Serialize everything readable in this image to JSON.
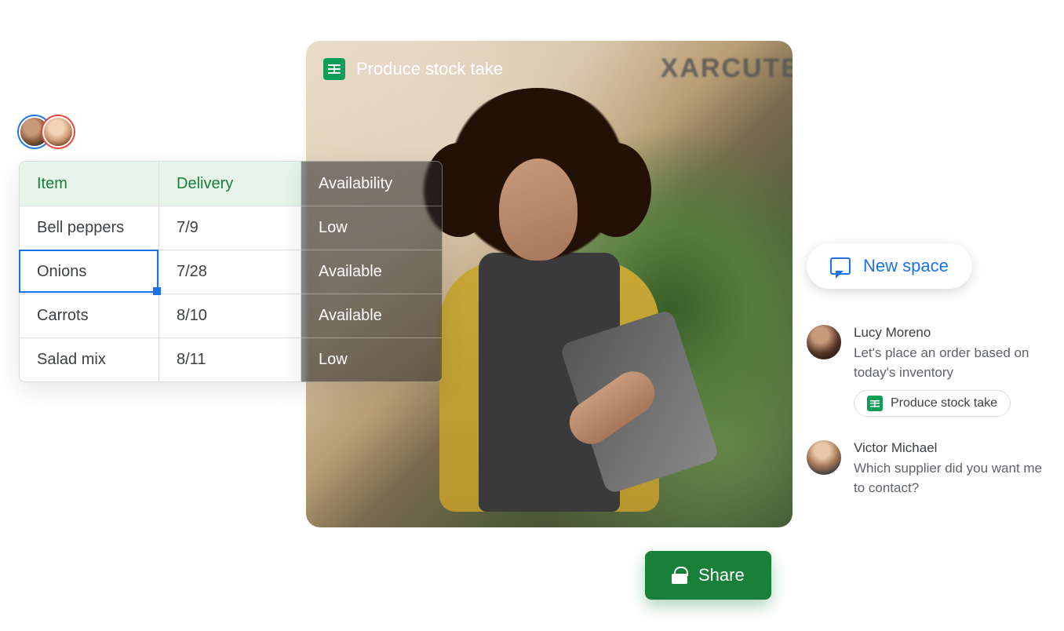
{
  "document": {
    "title": "Produce stock take"
  },
  "photo": {
    "sign_text": "XARCUTE"
  },
  "sheet": {
    "headers": {
      "item": "Item",
      "delivery": "Delivery",
      "availability": "Availability"
    },
    "rows": [
      {
        "item": "Bell peppers",
        "delivery": "7/9",
        "availability": "Low"
      },
      {
        "item": "Onions",
        "delivery": "7/28",
        "availability": "Available"
      },
      {
        "item": "Carrots",
        "delivery": "8/10",
        "availability": "Available"
      },
      {
        "item": "Salad mix",
        "delivery": "8/11",
        "availability": "Low"
      }
    ],
    "selected_cell": {
      "row": 1,
      "col": "item"
    }
  },
  "share_button": {
    "label": "Share"
  },
  "new_space": {
    "label": "New space"
  },
  "messages": [
    {
      "name": "Lucy Moreno",
      "text": "Let's place an order based on today's inventory",
      "attachment": "Produce stock take"
    },
    {
      "name": "Victor Michael",
      "text": "Which supplier did you want me to contact?"
    }
  ]
}
